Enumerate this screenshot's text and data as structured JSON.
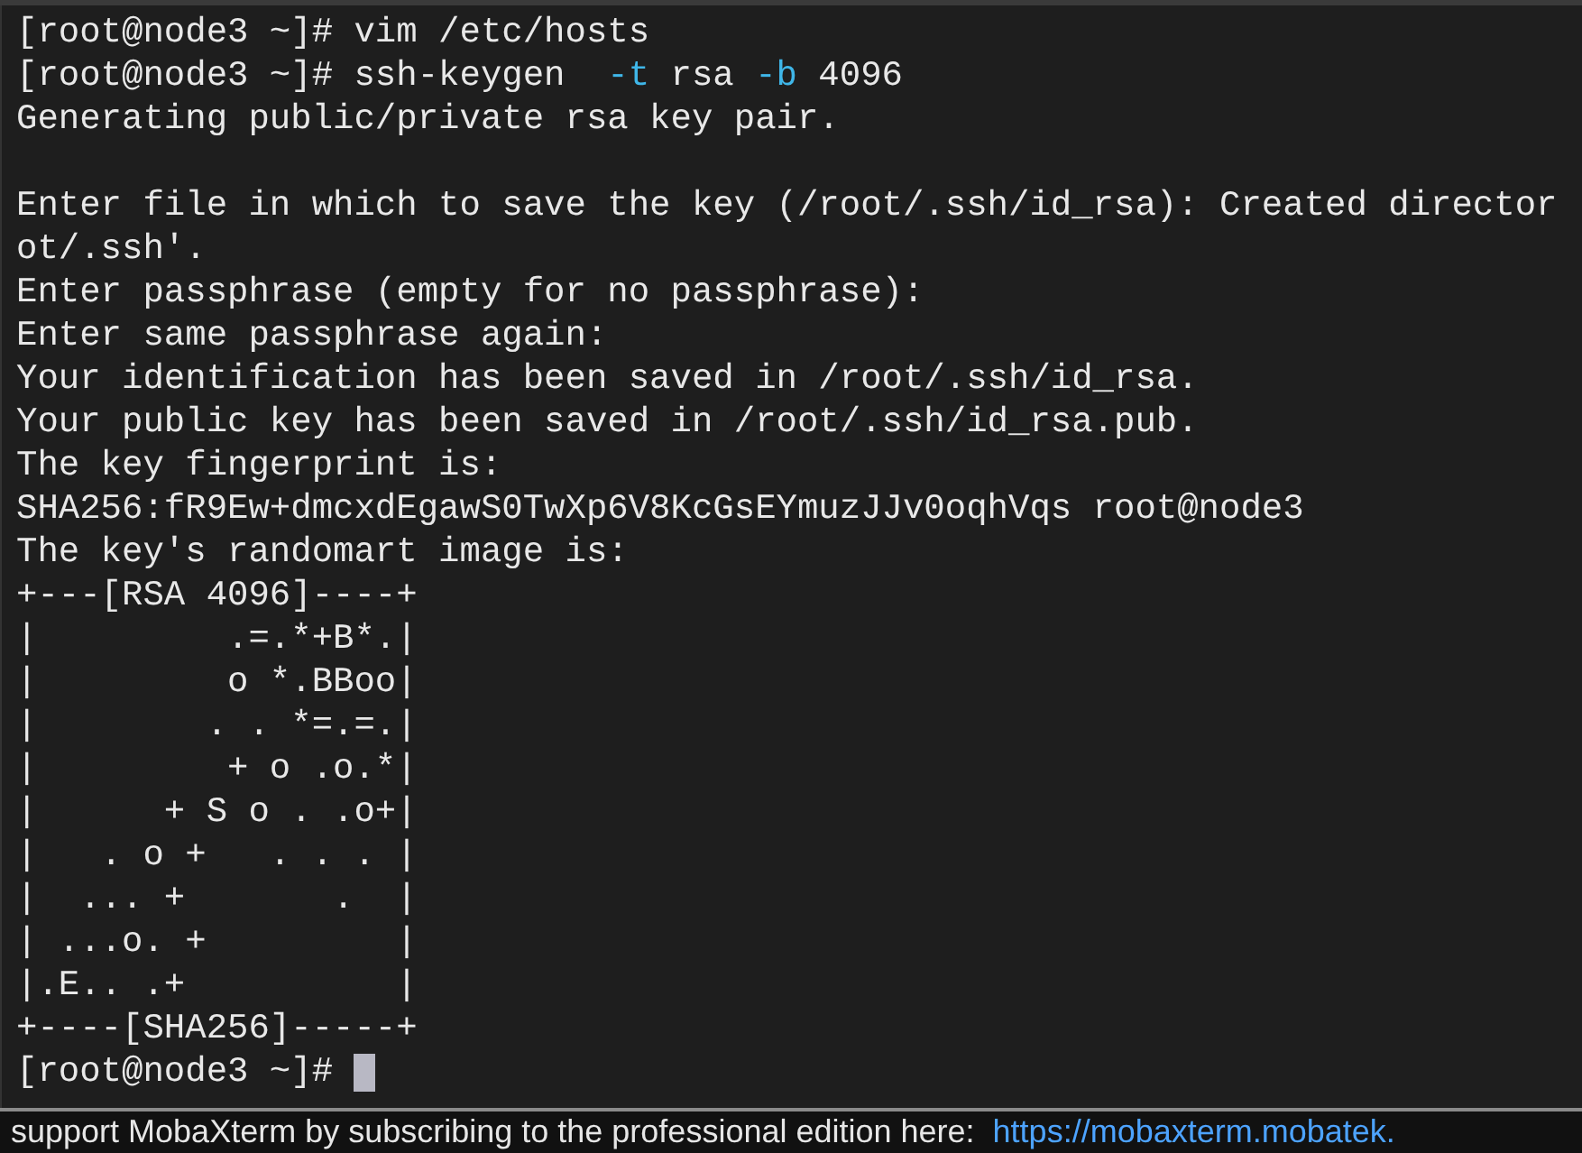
{
  "terminal": {
    "lines": [
      {
        "kind": "text",
        "parts": [
          {
            "kind": "plain",
            "text": "[root@node3 ~]# vim /etc/hosts"
          }
        ]
      },
      {
        "kind": "text",
        "parts": [
          {
            "kind": "plain",
            "text": "[root@node3 ~]# ssh-keygen  "
          },
          {
            "kind": "option",
            "text": "-t"
          },
          {
            "kind": "plain",
            "text": " rsa "
          },
          {
            "kind": "option",
            "text": "-b"
          },
          {
            "kind": "plain",
            "text": " 4096"
          }
        ]
      },
      {
        "kind": "text",
        "parts": [
          {
            "kind": "plain",
            "text": "Generating public/private rsa key pair."
          }
        ]
      },
      {
        "kind": "blank"
      },
      {
        "kind": "text",
        "parts": [
          {
            "kind": "plain",
            "text": "Enter file in which to save the key (/root/.ssh/id_rsa): Created director"
          }
        ]
      },
      {
        "kind": "text",
        "parts": [
          {
            "kind": "plain",
            "text": "ot/.ssh'."
          }
        ]
      },
      {
        "kind": "text",
        "parts": [
          {
            "kind": "plain",
            "text": "Enter passphrase (empty for no passphrase):"
          }
        ]
      },
      {
        "kind": "text",
        "parts": [
          {
            "kind": "plain",
            "text": "Enter same passphrase again:"
          }
        ]
      },
      {
        "kind": "text",
        "parts": [
          {
            "kind": "plain",
            "text": "Your identification has been saved in /root/.ssh/id_rsa."
          }
        ]
      },
      {
        "kind": "text",
        "parts": [
          {
            "kind": "plain",
            "text": "Your public key has been saved in /root/.ssh/id_rsa.pub."
          }
        ]
      },
      {
        "kind": "text",
        "parts": [
          {
            "kind": "plain",
            "text": "The key fingerprint is:"
          }
        ]
      },
      {
        "kind": "text",
        "parts": [
          {
            "kind": "plain",
            "text": "SHA256:fR9Ew+dmcxdEgawS0TwXp6V8KcGsEYmuzJJv0oqhVqs root@node3"
          }
        ]
      },
      {
        "kind": "text",
        "parts": [
          {
            "kind": "plain",
            "text": "The key's randomart image is:"
          }
        ]
      },
      {
        "kind": "text",
        "parts": [
          {
            "kind": "plain",
            "text": "+---[RSA 4096]----+"
          }
        ]
      },
      {
        "kind": "text",
        "parts": [
          {
            "kind": "plain",
            "text": "|         .=.*+B*.|"
          }
        ]
      },
      {
        "kind": "text",
        "parts": [
          {
            "kind": "plain",
            "text": "|         o *.BBoo|"
          }
        ]
      },
      {
        "kind": "text",
        "parts": [
          {
            "kind": "plain",
            "text": "|        . . *=.=.|"
          }
        ]
      },
      {
        "kind": "text",
        "parts": [
          {
            "kind": "plain",
            "text": "|         + o .o.*|"
          }
        ]
      },
      {
        "kind": "text",
        "parts": [
          {
            "kind": "plain",
            "text": "|      + S o . .o+|"
          }
        ]
      },
      {
        "kind": "text",
        "parts": [
          {
            "kind": "plain",
            "text": "|   . o +   . . . |"
          }
        ]
      },
      {
        "kind": "text",
        "parts": [
          {
            "kind": "plain",
            "text": "|  ... +       .  |"
          }
        ]
      },
      {
        "kind": "text",
        "parts": [
          {
            "kind": "plain",
            "text": "| ...o. +         |"
          }
        ]
      },
      {
        "kind": "text",
        "parts": [
          {
            "kind": "plain",
            "text": "|.E.. .+          |"
          }
        ]
      },
      {
        "kind": "text",
        "parts": [
          {
            "kind": "plain",
            "text": "+----[SHA256]-----+"
          }
        ]
      },
      {
        "kind": "prompt",
        "parts": [
          {
            "kind": "plain",
            "text": "[root@node3 ~]# "
          }
        ],
        "cursor": true
      }
    ]
  },
  "status_bar": {
    "message": "support MobaXterm by subscribing to the professional edition here:",
    "link": "https://mobaxterm.mobatek."
  }
}
